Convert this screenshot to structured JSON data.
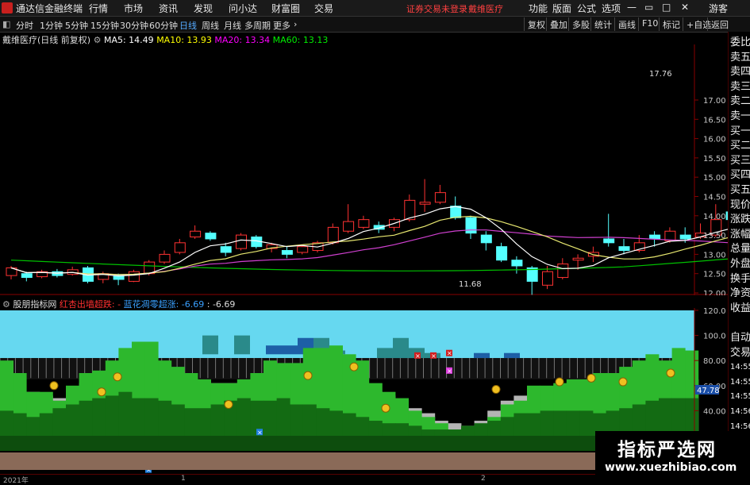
{
  "menu": {
    "app_title": "通达信金融终端",
    "items": [
      "行情",
      "市场",
      "资讯",
      "发现",
      "问小达",
      "财富圈",
      "交易"
    ],
    "status": "证券交易未登录",
    "stock_link": "戴维医疗",
    "right_items": [
      "功能",
      "版面",
      "公式",
      "选项"
    ],
    "guest": "游客"
  },
  "periods": {
    "items": [
      "分时",
      "1分钟",
      "5分钟",
      "15分钟",
      "30分钟",
      "60分钟",
      "日线",
      "周线",
      "月线",
      "多周期",
      "更多"
    ],
    "active": "日线",
    "right_buttons": [
      "复权",
      "叠加",
      "多股",
      "统计",
      "画线",
      "F10",
      "标记",
      "+自选",
      "返回"
    ]
  },
  "main_chart": {
    "title": "戴维医疗(日线 前复权)",
    "ma": [
      {
        "label": "MA5: 14.49",
        "color": "#ffffff"
      },
      {
        "label": "MA10: 13.93",
        "color": "#ffff00"
      },
      {
        "label": "MA20: 13.34",
        "color": "#ff00ff"
      },
      {
        "label": "MA60: 13.13",
        "color": "#00e000"
      }
    ],
    "high_label": "17.76",
    "low_label": "11.68",
    "y_ticks": [
      "17.00",
      "16.50",
      "16.00",
      "15.50",
      "15.00",
      "14.50",
      "14.00",
      "13.50",
      "13.00",
      "12.50",
      "12.00"
    ]
  },
  "sub_chart": {
    "title": "股朋指标网",
    "legend1": "红杏出墙超跌:",
    "legend2": "蓝花凋零超涨: -6.69",
    "legend3": ": -6.69",
    "y_ticks": [
      "120.0",
      "100.0",
      "80.00",
      "60.00",
      "40.00",
      "20.00"
    ],
    "current": "47.78"
  },
  "right_panel": [
    "委比",
    "卖五",
    "卖四",
    "卖三",
    "卖二",
    "卖一",
    "买一",
    "买二",
    "买三",
    "买四",
    "买五",
    "现价",
    "涨跌",
    "涨幅",
    "总量",
    "外盘",
    "换手",
    "净资",
    "收益",
    "",
    "自动",
    "交易",
    "14:55",
    "14:55",
    "14:55",
    "14:56",
    "14:56",
    "14:56",
    "14:56",
    "14:56"
  ],
  "bottom": {
    "year": "2021年",
    "m1": "1",
    "m2": "2"
  },
  "watermark": {
    "title": "指标严选网",
    "url": "www.xuezhibiao.com"
  },
  "colors": {
    "up": "#ff3232",
    "down": "#54ffff",
    "bg": "#000000"
  }
}
